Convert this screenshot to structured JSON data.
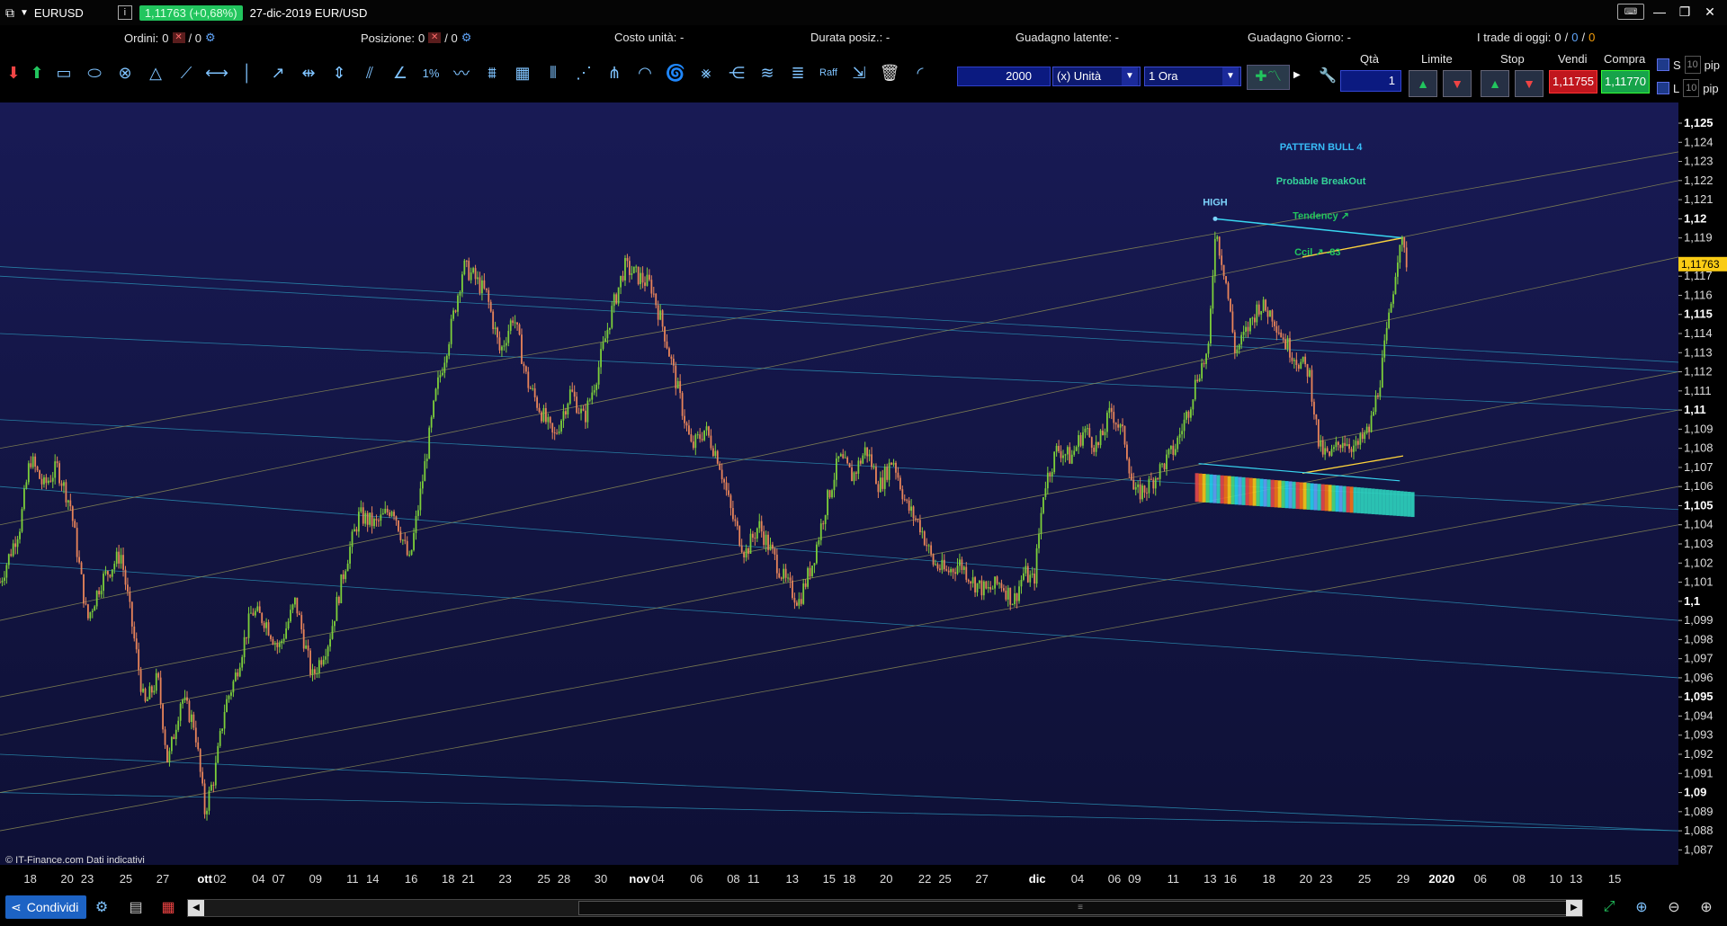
{
  "title_bar": {
    "symbol": "EURUSD",
    "price_pill": "1,11763 (+0,68%)",
    "window_title": "27-dic-2019 EUR/USD",
    "info_icon": "i",
    "keyboard_label": "⌨"
  },
  "stats": {
    "ordini_label": "Ordini:",
    "ordini_value": "0",
    "ordini_total": "/ 0",
    "posizione_label": "Posizione:",
    "posizione_value": "0",
    "posizione_total": "/ 0",
    "costo_label": "Costo unità: -",
    "durata_label": "Durata posiz.: -",
    "guadagno_latente_label": "Guadagno latente: -",
    "guadagno_giorno_label": "Guadagno Giorno: -",
    "trade_oggi_label": "I trade di oggi:",
    "trade_a": "0",
    "trade_b": "0",
    "trade_c": "0"
  },
  "toolbar": {
    "quantity": "2000",
    "unit_select": "(x) Unità",
    "timeframe_select": "1 Ora",
    "raff_label": "Raff",
    "pct_label": "1%"
  },
  "order_panel": {
    "qta_label": "Qtà",
    "qta_value": "1",
    "limite_label": "Limite",
    "stop_label": "Stop",
    "vendi_label": "Vendi",
    "compra_label": "Compra",
    "sell_price": "1,11755",
    "buy_price": "1,11770",
    "s_label": "S",
    "l_label": "L",
    "pip_value_s": "10",
    "pip_value_l": "10",
    "pip_label": "pip"
  },
  "chart_data": {
    "type": "candlestick",
    "symbol": "EURUSD",
    "timeframe": "1 Ora",
    "current_price": "1,11763",
    "ylim": [
      1.0865,
      1.1258
    ],
    "y_ticks": [
      {
        "v": 1.125,
        "label": "1,125",
        "bold": true
      },
      {
        "v": 1.124,
        "label": "1,124"
      },
      {
        "v": 1.123,
        "label": "1,123"
      },
      {
        "v": 1.122,
        "label": "1,122"
      },
      {
        "v": 1.121,
        "label": "1,121"
      },
      {
        "v": 1.12,
        "label": "1,12",
        "bold": true
      },
      {
        "v": 1.119,
        "label": "1,119"
      },
      {
        "v": 1.117,
        "label": "1,117"
      },
      {
        "v": 1.116,
        "label": "1,116"
      },
      {
        "v": 1.115,
        "label": "1,115",
        "bold": true
      },
      {
        "v": 1.114,
        "label": "1,114"
      },
      {
        "v": 1.113,
        "label": "1,113"
      },
      {
        "v": 1.112,
        "label": "1,112"
      },
      {
        "v": 1.111,
        "label": "1,111"
      },
      {
        "v": 1.11,
        "label": "1,11",
        "bold": true
      },
      {
        "v": 1.109,
        "label": "1,109"
      },
      {
        "v": 1.108,
        "label": "1,108"
      },
      {
        "v": 1.107,
        "label": "1,107"
      },
      {
        "v": 1.106,
        "label": "1,106"
      },
      {
        "v": 1.105,
        "label": "1,105",
        "bold": true
      },
      {
        "v": 1.104,
        "label": "1,104"
      },
      {
        "v": 1.103,
        "label": "1,103"
      },
      {
        "v": 1.102,
        "label": "1,102"
      },
      {
        "v": 1.101,
        "label": "1,101"
      },
      {
        "v": 1.1,
        "label": "1,1",
        "bold": true
      },
      {
        "v": 1.099,
        "label": "1,099"
      },
      {
        "v": 1.098,
        "label": "1,098"
      },
      {
        "v": 1.097,
        "label": "1,097"
      },
      {
        "v": 1.096,
        "label": "1,096"
      },
      {
        "v": 1.095,
        "label": "1,095",
        "bold": true
      },
      {
        "v": 1.094,
        "label": "1,094"
      },
      {
        "v": 1.093,
        "label": "1,093"
      },
      {
        "v": 1.092,
        "label": "1,092"
      },
      {
        "v": 1.091,
        "label": "1,091"
      },
      {
        "v": 1.09,
        "label": "1,09",
        "bold": true
      },
      {
        "v": 1.089,
        "label": "1,089"
      },
      {
        "v": 1.088,
        "label": "1,088"
      },
      {
        "v": 1.087,
        "label": "1,087"
      }
    ],
    "x_labels": [
      {
        "t": 0.018,
        "label": "18"
      },
      {
        "t": 0.04,
        "label": "20"
      },
      {
        "t": 0.052,
        "label": "23"
      },
      {
        "t": 0.075,
        "label": "25"
      },
      {
        "t": 0.097,
        "label": "27"
      },
      {
        "t": 0.122,
        "label": "ott",
        "bold": true
      },
      {
        "t": 0.131,
        "label": "02"
      },
      {
        "t": 0.154,
        "label": "04"
      },
      {
        "t": 0.166,
        "label": "07"
      },
      {
        "t": 0.188,
        "label": "09"
      },
      {
        "t": 0.21,
        "label": "11"
      },
      {
        "t": 0.222,
        "label": "14"
      },
      {
        "t": 0.245,
        "label": "16"
      },
      {
        "t": 0.267,
        "label": "18"
      },
      {
        "t": 0.279,
        "label": "21"
      },
      {
        "t": 0.301,
        "label": "23"
      },
      {
        "t": 0.324,
        "label": "25"
      },
      {
        "t": 0.336,
        "label": "28"
      },
      {
        "t": 0.358,
        "label": "30"
      },
      {
        "t": 0.381,
        "label": "nov",
        "bold": true
      },
      {
        "t": 0.392,
        "label": "04"
      },
      {
        "t": 0.415,
        "label": "06"
      },
      {
        "t": 0.437,
        "label": "08"
      },
      {
        "t": 0.449,
        "label": "11"
      },
      {
        "t": 0.472,
        "label": "13"
      },
      {
        "t": 0.494,
        "label": "15"
      },
      {
        "t": 0.506,
        "label": "18"
      },
      {
        "t": 0.528,
        "label": "20"
      },
      {
        "t": 0.551,
        "label": "22"
      },
      {
        "t": 0.563,
        "label": "25"
      },
      {
        "t": 0.585,
        "label": "27"
      },
      {
        "t": 0.618,
        "label": "dic",
        "bold": true
      },
      {
        "t": 0.642,
        "label": "04"
      },
      {
        "t": 0.664,
        "label": "06"
      },
      {
        "t": 0.676,
        "label": "09"
      },
      {
        "t": 0.699,
        "label": "11"
      },
      {
        "t": 0.721,
        "label": "13"
      },
      {
        "t": 0.733,
        "label": "16"
      },
      {
        "t": 0.756,
        "label": "18"
      },
      {
        "t": 0.778,
        "label": "20"
      },
      {
        "t": 0.79,
        "label": "23"
      },
      {
        "t": 0.813,
        "label": "25"
      },
      {
        "t": 0.836,
        "label": "29"
      },
      {
        "t": 0.859,
        "label": "2020",
        "bold": true
      },
      {
        "t": 0.882,
        "label": "06"
      },
      {
        "t": 0.905,
        "label": "08"
      },
      {
        "t": 0.927,
        "label": "10"
      },
      {
        "t": 0.939,
        "label": "13"
      },
      {
        "t": 0.962,
        "label": "15"
      }
    ],
    "price_path": [
      [
        0.0,
        1.101
      ],
      [
        0.012,
        1.104
      ],
      [
        0.018,
        1.1075
      ],
      [
        0.026,
        1.106
      ],
      [
        0.034,
        1.107
      ],
      [
        0.042,
        1.105
      ],
      [
        0.052,
        1.099
      ],
      [
        0.06,
        1.101
      ],
      [
        0.072,
        1.1025
      ],
      [
        0.08,
        1.098
      ],
      [
        0.086,
        1.0945
      ],
      [
        0.094,
        1.096
      ],
      [
        0.1,
        1.0915
      ],
      [
        0.108,
        1.095
      ],
      [
        0.116,
        1.0935
      ],
      [
        0.122,
        1.089
      ],
      [
        0.128,
        1.091
      ],
      [
        0.134,
        1.0945
      ],
      [
        0.14,
        1.096
      ],
      [
        0.15,
        1.0995
      ],
      [
        0.158,
        1.099
      ],
      [
        0.166,
        1.0975
      ],
      [
        0.176,
        1.1
      ],
      [
        0.186,
        1.096
      ],
      [
        0.196,
        1.098
      ],
      [
        0.206,
        1.102
      ],
      [
        0.214,
        1.1045
      ],
      [
        0.224,
        1.104
      ],
      [
        0.234,
        1.105
      ],
      [
        0.244,
        1.102
      ],
      [
        0.252,
        1.1065
      ],
      [
        0.26,
        1.111
      ],
      [
        0.268,
        1.114
      ],
      [
        0.276,
        1.1175
      ],
      [
        0.282,
        1.117
      ],
      [
        0.29,
        1.116
      ],
      [
        0.298,
        1.113
      ],
      [
        0.306,
        1.115
      ],
      [
        0.314,
        1.1115
      ],
      [
        0.322,
        1.11
      ],
      [
        0.33,
        1.1085
      ],
      [
        0.34,
        1.111
      ],
      [
        0.348,
        1.1095
      ],
      [
        0.356,
        1.112
      ],
      [
        0.364,
        1.115
      ],
      [
        0.372,
        1.1175
      ],
      [
        0.38,
        1.117
      ],
      [
        0.388,
        1.1165
      ],
      [
        0.396,
        1.114
      ],
      [
        0.404,
        1.111
      ],
      [
        0.412,
        1.108
      ],
      [
        0.42,
        1.109
      ],
      [
        0.428,
        1.1075
      ],
      [
        0.436,
        1.1045
      ],
      [
        0.444,
        1.1025
      ],
      [
        0.452,
        1.104
      ],
      [
        0.46,
        1.1025
      ],
      [
        0.468,
        1.101
      ],
      [
        0.476,
        1.1
      ],
      [
        0.484,
        1.102
      ],
      [
        0.492,
        1.105
      ],
      [
        0.5,
        1.1075
      ],
      [
        0.508,
        1.1065
      ],
      [
        0.516,
        1.108
      ],
      [
        0.524,
        1.106
      ],
      [
        0.532,
        1.1075
      ],
      [
        0.54,
        1.105
      ],
      [
        0.548,
        1.104
      ],
      [
        0.556,
        1.102
      ],
      [
        0.564,
        1.1015
      ],
      [
        0.572,
        1.102
      ],
      [
        0.58,
        1.101
      ],
      [
        0.588,
        1.1005
      ],
      [
        0.596,
        1.101
      ],
      [
        0.604,
        1.1
      ],
      [
        0.61,
        1.1015
      ],
      [
        0.616,
        1.101
      ],
      [
        0.622,
        1.106
      ],
      [
        0.63,
        1.108
      ],
      [
        0.638,
        1.1075
      ],
      [
        0.646,
        1.109
      ],
      [
        0.654,
        1.108
      ],
      [
        0.662,
        1.11
      ],
      [
        0.67,
        1.1085
      ],
      [
        0.676,
        1.1055
      ],
      [
        0.684,
        1.106
      ],
      [
        0.692,
        1.107
      ],
      [
        0.7,
        1.108
      ],
      [
        0.708,
        1.11
      ],
      [
        0.714,
        1.112
      ],
      [
        0.72,
        1.113
      ],
      [
        0.724,
        1.1195
      ],
      [
        0.73,
        1.117
      ],
      [
        0.736,
        1.113
      ],
      [
        0.742,
        1.114
      ],
      [
        0.75,
        1.1155
      ],
      [
        0.758,
        1.115
      ],
      [
        0.766,
        1.1135
      ],
      [
        0.774,
        1.1125
      ],
      [
        0.78,
        1.112
      ],
      [
        0.786,
        1.108
      ],
      [
        0.792,
        1.1075
      ],
      [
        0.8,
        1.1085
      ],
      [
        0.808,
        1.108
      ],
      [
        0.816,
        1.109
      ],
      [
        0.822,
        1.1115
      ],
      [
        0.828,
        1.115
      ],
      [
        0.834,
        1.119
      ],
      [
        0.838,
        1.1178
      ]
    ],
    "annotations": [
      {
        "t": 0.787,
        "v": 1.1236,
        "text": "PATTERN BULL 4",
        "color": "#38bdf8"
      },
      {
        "t": 0.787,
        "v": 1.1218,
        "text": "Probable BreakOut",
        "color": "#34d399"
      },
      {
        "t": 0.787,
        "v": 1.12,
        "text": "Tendency ↗",
        "color": "#22c55e"
      },
      {
        "t": 0.785,
        "v": 1.1181,
        "text": "Ccil ↗ -83",
        "color": "#22c55e"
      },
      {
        "t": 0.724,
        "v": 1.1207,
        "text": "HIGH",
        "color": "#7dd3fc"
      }
    ],
    "copyright": "© IT-Finance.com  Dati indicativi",
    "grid": false
  },
  "bottom": {
    "share_label": "Condividi"
  }
}
